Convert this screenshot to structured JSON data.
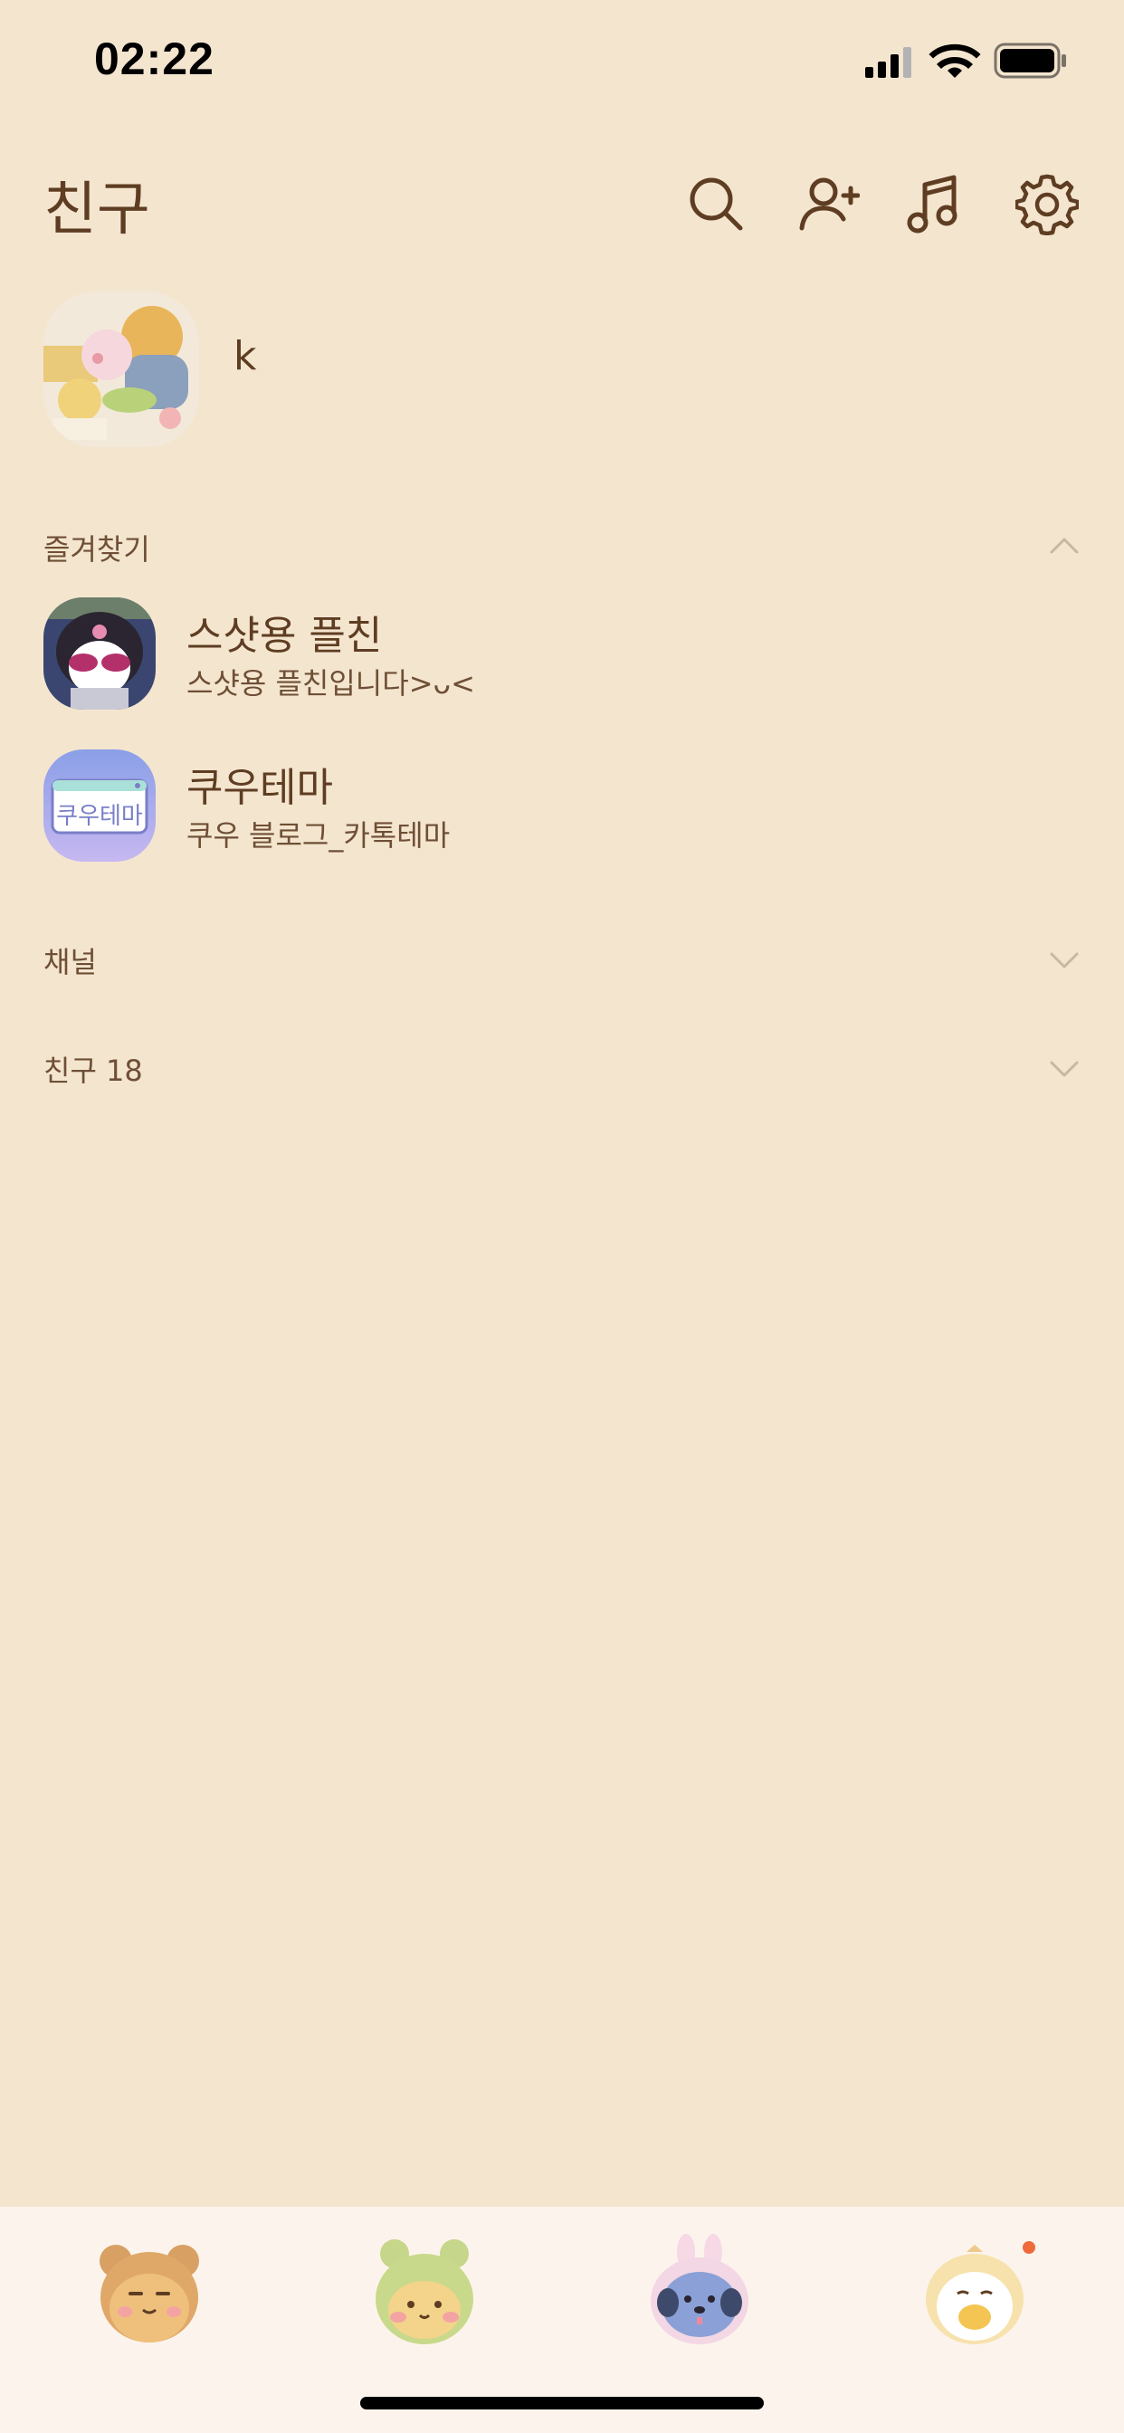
{
  "status_bar": {
    "time": "02:22"
  },
  "header": {
    "title": "친구",
    "icons": [
      "search-icon",
      "add-friend-icon",
      "music-icon",
      "settings-icon"
    ]
  },
  "profile": {
    "name": "k"
  },
  "favorites": {
    "label": "즐겨찾기",
    "expanded": true,
    "items": [
      {
        "name": "스샷용 플친",
        "status": "스샷용 플친입니다>ᴗ<"
      },
      {
        "name": "쿠우테마",
        "status": "쿠우 블로그_카톡테마",
        "avatar_text": "쿠우테마"
      }
    ]
  },
  "channels": {
    "label": "채널",
    "expanded": false
  },
  "friends": {
    "label": "친구 18",
    "expanded": false
  },
  "tabbar": {
    "tabs": [
      "friends-tab",
      "chats-tab",
      "view-tab",
      "more-tab"
    ],
    "has_notification_on_more": true
  },
  "colors": {
    "background": "#f4e5cf",
    "text": "#5e3d22",
    "tabbar": "#fcf4ec",
    "notification": "#ee6a3b"
  }
}
